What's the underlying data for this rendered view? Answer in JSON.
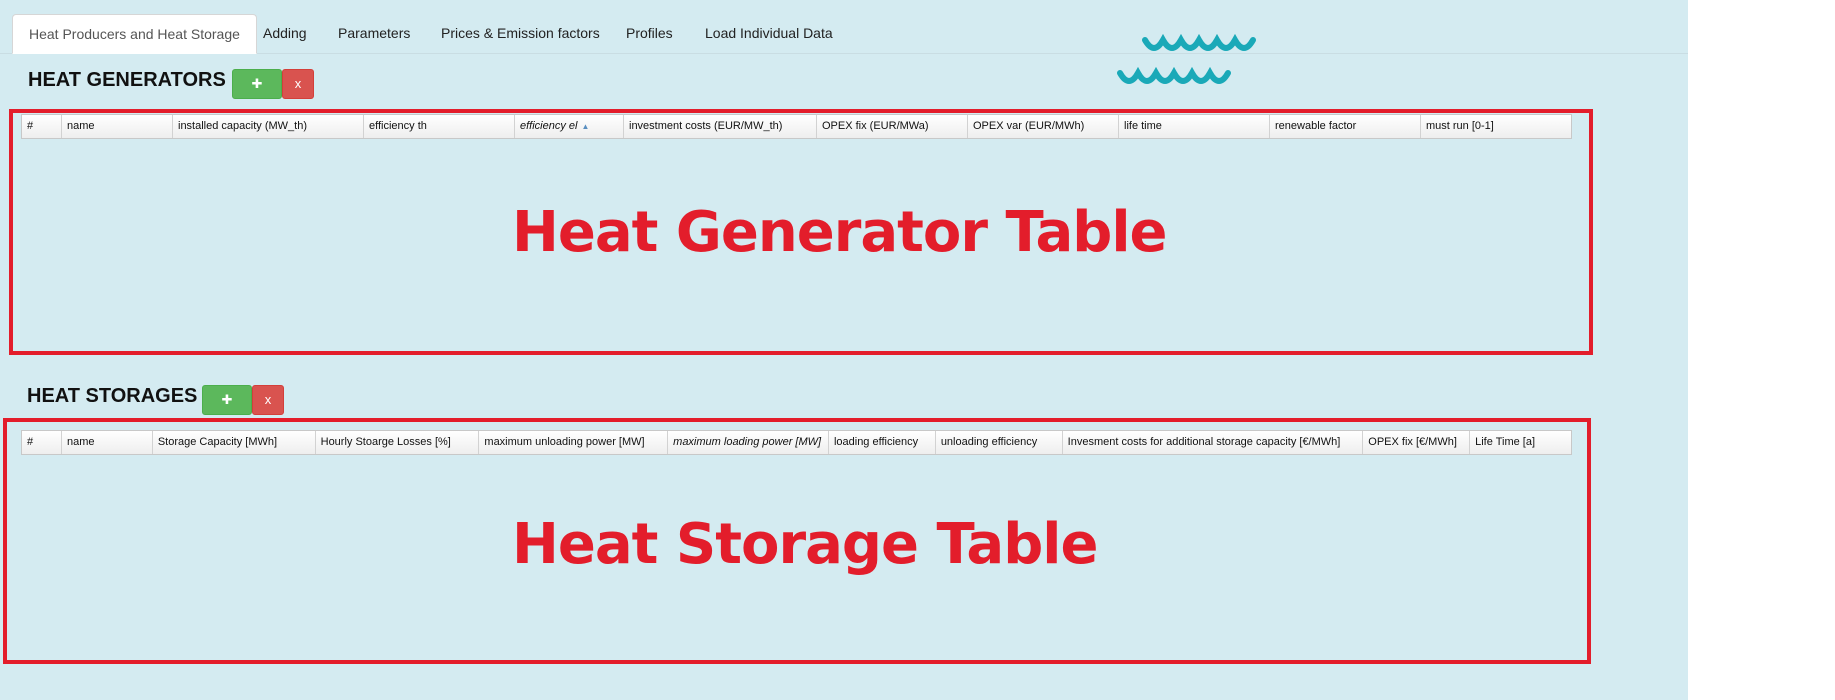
{
  "tabs": [
    {
      "label": "Heat Producers and Heat Storage",
      "active": true
    },
    {
      "label": "Adding"
    },
    {
      "label": "Parameters"
    },
    {
      "label": "Prices & Emission factors"
    },
    {
      "label": "Profiles"
    },
    {
      "label": "Load Individual Data"
    }
  ],
  "generators": {
    "title": "HEAT GENERATORS",
    "add_label": "✚",
    "remove_label": "x",
    "columns": [
      "#",
      "name",
      "installed capacity (MW_th)",
      "efficiency th",
      "efficiency el",
      "investment costs (EUR/MW_th)",
      "OPEX fix (EUR/MWa)",
      "OPEX var (EUR/MWh)",
      "life time",
      "renewable factor",
      "must run [0-1]"
    ],
    "overlay": "Heat Generator Table"
  },
  "storages": {
    "title": "HEAT STORAGES",
    "add_label": "✚",
    "remove_label": "x",
    "columns": [
      "#",
      "name",
      "Storage Capacity [MWh]",
      "Hourly Stoarge Losses [%]",
      "maximum unloading power [MW]",
      "maximum loading power [MW]",
      "loading efficiency",
      "unloading efficiency",
      "Invesment costs for additional storage capacity [€/MWh]",
      "OPEX fix [€/MWh]",
      "Life Time [a]"
    ],
    "overlay": "Heat Storage Table"
  },
  "colors": {
    "background": "#d4ebf1",
    "frame": "#e31d2b",
    "add_button": "#5cb85c",
    "remove_button": "#d9534f",
    "logo": "#1aa9b8"
  },
  "logo_icon": "waves-logo-icon"
}
